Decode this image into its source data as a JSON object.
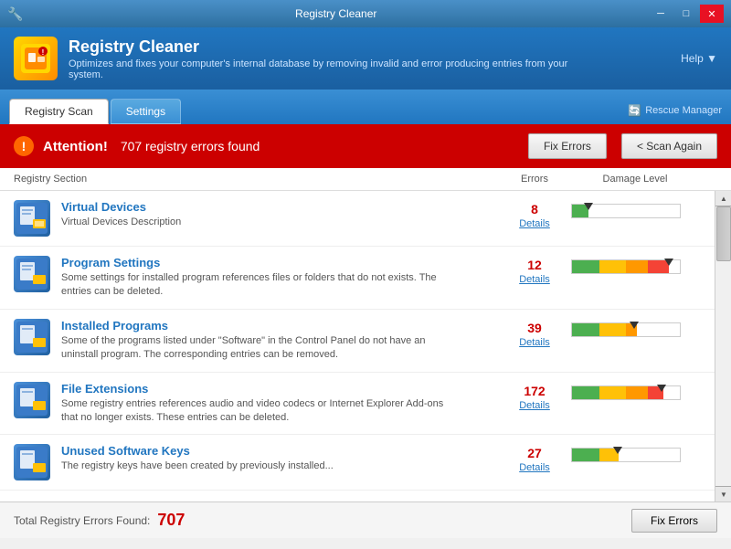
{
  "titlebar": {
    "title": "Registry Cleaner",
    "icon": "🔧",
    "min_label": "─",
    "max_label": "□",
    "close_label": "✕"
  },
  "header": {
    "app_name": "Registry Cleaner",
    "description": "Optimizes and fixes your computer's internal database by removing invalid and error producing entries from your system.",
    "help_label": "Help ▼"
  },
  "tabs": [
    {
      "label": "Registry Scan",
      "active": true
    },
    {
      "label": "Settings",
      "active": false
    }
  ],
  "rescue_manager": "Rescue Manager",
  "attention": {
    "icon": "!",
    "label": "Attention!",
    "message": "707 registry errors found",
    "fix_btn": "Fix Errors",
    "scan_btn": "< Scan Again"
  },
  "table_headers": {
    "section": "Registry Section",
    "errors": "Errors",
    "damage": "Damage Level"
  },
  "items": [
    {
      "title": "Virtual Devices",
      "description": "Virtual Devices Description",
      "errors": "8",
      "details": "Details",
      "damage_pct": 15,
      "damage_type": "low"
    },
    {
      "title": "Program Settings",
      "description": "Some settings for installed program references files or folders that do not exists. The entries can be deleted.",
      "errors": "12",
      "details": "Details",
      "damage_pct": 85,
      "damage_type": "high"
    },
    {
      "title": "Installed Programs",
      "description": "Some of the programs listed under \"Software\" in the Control Panel do not have an uninstall program. The corresponding entries can be removed.",
      "errors": "39",
      "details": "Details",
      "damage_pct": 55,
      "damage_type": "medium"
    },
    {
      "title": "File Extensions",
      "description": "Some registry entries references audio and video codecs or Internet Explorer Add-ons that no longer exists. These entries can be deleted.",
      "errors": "172",
      "details": "Details",
      "damage_pct": 80,
      "damage_type": "high"
    },
    {
      "title": "Unused Software Keys",
      "description": "The registry keys have been created by previously installed...",
      "errors": "27",
      "details": "Details",
      "damage_pct": 40,
      "damage_type": "medium-low"
    }
  ],
  "footer": {
    "label": "Total Registry Errors Found:",
    "count": "707",
    "fix_btn": "Fix Errors"
  },
  "colors": {
    "accent_blue": "#2176c0",
    "error_red": "#cc0000",
    "header_bg": "#2176c0"
  }
}
